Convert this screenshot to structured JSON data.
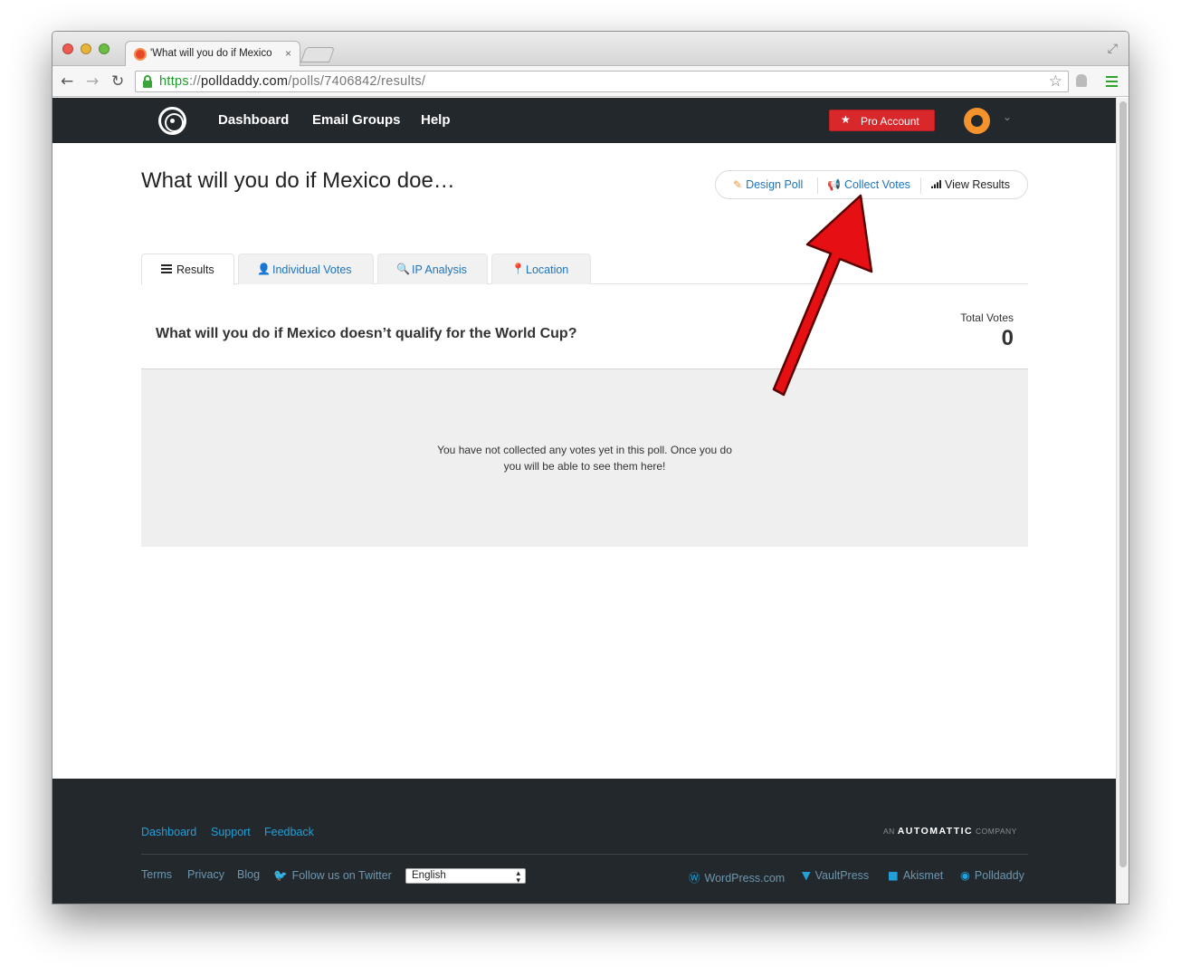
{
  "browser": {
    "tab_title": "'What will you do if Mexico",
    "tab_close": "×",
    "url_scheme": "https",
    "url_sep": "://",
    "url_host": "polldaddy.com",
    "url_path": "/polls/7406842/results/"
  },
  "masthead": {
    "nav": [
      "Dashboard",
      "Email Groups",
      "Help"
    ],
    "pro_button": "Pro Account"
  },
  "poll": {
    "title": "What will you do if Mexico doe…",
    "actions": {
      "design": "Design Poll",
      "collect": "Collect Votes",
      "view": "View Results"
    },
    "tabs": {
      "results": "Results",
      "individual": "Individual Votes",
      "ip": "IP Analysis",
      "location": "Location"
    },
    "question": "What will you do if Mexico doesn’t qualify for the World Cup?",
    "total_label": "Total Votes",
    "total_value": "0",
    "empty_message": "You have not collected any votes yet in this poll. Once you do you will be able to see them here!"
  },
  "footer": {
    "links": [
      "Dashboard",
      "Support",
      "Feedback"
    ],
    "automattic_prefix": "AN",
    "automattic_brand": "AUTOMATTIC",
    "automattic_suffix": "COMPANY",
    "sub_links": [
      "Terms",
      "Privacy",
      "Blog"
    ],
    "twitter": "Follow us on Twitter",
    "language": "English",
    "partners": [
      "WordPress.com",
      "VaultPress",
      "Akismet",
      "Polldaddy"
    ]
  },
  "colors": {
    "annotation_arrow": "#e50f14",
    "link": "#1e73be",
    "accent": "#f4932d",
    "pro_button": "#d9282b",
    "masthead": "#23282d"
  }
}
